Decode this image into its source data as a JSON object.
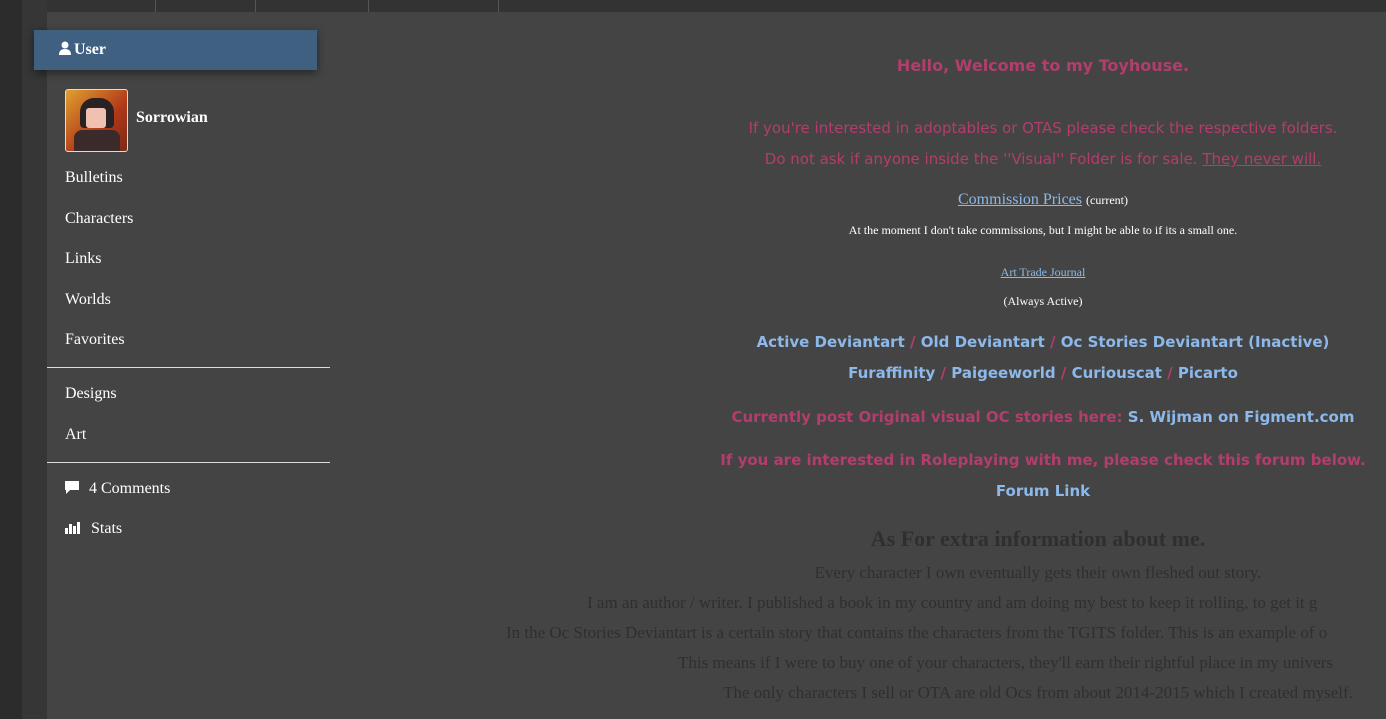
{
  "sidebar": {
    "header": "User",
    "username": "Sorrowian",
    "items": [
      {
        "label": "Bulletins"
      },
      {
        "label": "Characters"
      },
      {
        "label": "Links"
      },
      {
        "label": "Worlds"
      },
      {
        "label": "Favorites"
      }
    ],
    "items2": [
      {
        "label": "Designs"
      },
      {
        "label": "Art"
      }
    ],
    "comments": "4 Comments",
    "stats": "Stats"
  },
  "main": {
    "welcome": "Hello, Welcome to my Toyhouse.",
    "adopt_line": "If you're interested in adoptables or OTAS please check the respective folders.",
    "visual_line": "Do not ask if anyone inside the ''Visual'' Folder is for sale.",
    "never": "They never will.",
    "commission_link": "Commission Prices",
    "current": "(current)",
    "commission_note": "At the moment I don't take commissions, but I might be able to if its a small one.",
    "art_trade_link": "Art Trade Journal",
    "always_active": "(Always Active)",
    "links_row1": [
      "Active Deviantart",
      "Old Deviantart",
      "Oc Stories Deviantart (Inactive)"
    ],
    "links_row2": [
      "Furaffinity",
      "Paigeeworld",
      "Curiouscat",
      "Picarto"
    ],
    "sep": "/",
    "figment_prefix": "Currently post Original visual OC stories here:",
    "figment_link": "S. Wijman on Figment.com",
    "rp_line": "If you are interested in Roleplaying with me, please check this forum below.",
    "forum_link": "Forum Link",
    "extra_heading": "As For extra information about me.",
    "extra_lines": [
      "Every character I own eventually gets their own fleshed out story.",
      "I am an author / writer. I published a book in my country and am doing my best to keep it rolling, to get it g",
      "In the Oc Stories Deviantart is a certain story that contains the characters from the TGITS folder. This is an example of o",
      "This means if I were to buy one of your characters, they'll earn their rightful place in my univers",
      "The only characters I sell or OTA are old Ocs from about 2014-2015 which I created myself."
    ]
  },
  "colors": {
    "accent": "#3f6081",
    "pink": "#b33d6c",
    "link": "#8cb9ea",
    "background": "#444444"
  }
}
